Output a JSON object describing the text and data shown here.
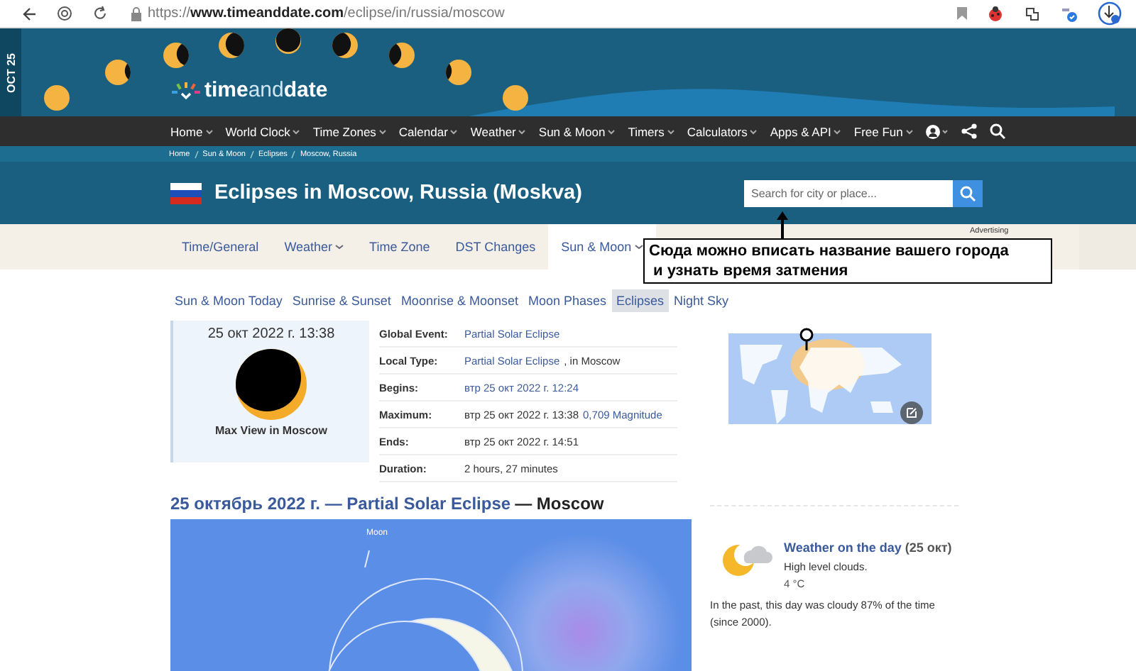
{
  "browser": {
    "url_scheme": "https://",
    "url_host": "www.timeanddate.com",
    "url_path": "/eclipse/in/russia/moscow"
  },
  "banner": {
    "date_tab": "OCT 25",
    "logo": {
      "part_1": "time",
      "part_2": "and",
      "part_3": "date"
    }
  },
  "nav": {
    "items": [
      {
        "label": "Home",
        "dropdown": true
      },
      {
        "label": "World Clock",
        "dropdown": true
      },
      {
        "label": "Time Zones",
        "dropdown": true
      },
      {
        "label": "Calendar",
        "dropdown": true
      },
      {
        "label": "Weather",
        "dropdown": true
      },
      {
        "label": "Sun & Moon",
        "dropdown": true
      },
      {
        "label": "Timers",
        "dropdown": true
      },
      {
        "label": "Calculators",
        "dropdown": true
      },
      {
        "label": "Apps & API",
        "dropdown": true
      },
      {
        "label": "Free Fun",
        "dropdown": true
      }
    ]
  },
  "breadcrumb": [
    "Home",
    "Sun & Moon",
    "Eclipses",
    "Moscow, Russia"
  ],
  "title": "Eclipses in Moscow, Russia (Moskva)",
  "search": {
    "placeholder": "Search for city or place..."
  },
  "tabs": [
    {
      "label": "Time/General",
      "dropdown": false,
      "selected": false
    },
    {
      "label": "Weather",
      "dropdown": true,
      "selected": false
    },
    {
      "label": "Time Zone",
      "dropdown": false,
      "selected": false
    },
    {
      "label": "DST Changes",
      "dropdown": false,
      "selected": false
    },
    {
      "label": "Sun & Moon",
      "dropdown": true,
      "selected": true
    }
  ],
  "advertising": "Advertising",
  "annotation": {
    "lines": [
      "Сюда можно вписать название вашего города",
      "и узнать время затмения"
    ]
  },
  "subtabs": [
    {
      "label": "Sun & Moon Today",
      "selected": false
    },
    {
      "label": "Sunrise & Sunset",
      "selected": false
    },
    {
      "label": "Moonrise & Moonset",
      "selected": false
    },
    {
      "label": "Moon Phases",
      "selected": false
    },
    {
      "label": "Eclipses",
      "selected": true
    },
    {
      "label": "Night Sky",
      "selected": false
    }
  ],
  "max_view": {
    "datetime": "25 окт 2022 г. 13:38",
    "caption": "Max View in Moscow"
  },
  "details": [
    {
      "label": "Global Event:",
      "value": [
        {
          "kind": "link",
          "text": "Partial Solar Eclipse"
        }
      ]
    },
    {
      "label": "Local Type:",
      "value": [
        {
          "kind": "link",
          "text": "Partial Solar Eclipse"
        },
        {
          "kind": "plain",
          "text": ", in Moscow"
        }
      ]
    },
    {
      "label": "Begins:",
      "value": [
        {
          "kind": "link",
          "text": "втр 25 окт 2022 г. 12:24"
        }
      ]
    },
    {
      "label": "Maximum:",
      "value": [
        {
          "kind": "plain",
          "text": "втр 25 окт 2022 г. 13:38"
        },
        {
          "kind": "link",
          "text": "0,709 Magnitude"
        }
      ]
    },
    {
      "label": "Ends:",
      "value": [
        {
          "kind": "plain",
          "text": "втр 25 окт 2022 г. 14:51"
        }
      ]
    },
    {
      "label": "Duration:",
      "value": [
        {
          "kind": "plain",
          "text": "2 hours, 27 minutes"
        }
      ]
    }
  ],
  "heading": [
    {
      "kind": "link",
      "text": "25 октябрь 2022 г. — Partial Solar Eclipse"
    },
    {
      "kind": "plain",
      "text": "— Moscow"
    }
  ],
  "diagram": {
    "moon_label": "Moon"
  },
  "weather": {
    "title": "Weather on the day",
    "date": "(25 окт)",
    "description": "High level clouds.",
    "temperature": "4 °C",
    "note": "In the past, this day was cloudy 87% of the time (since 2000)."
  }
}
